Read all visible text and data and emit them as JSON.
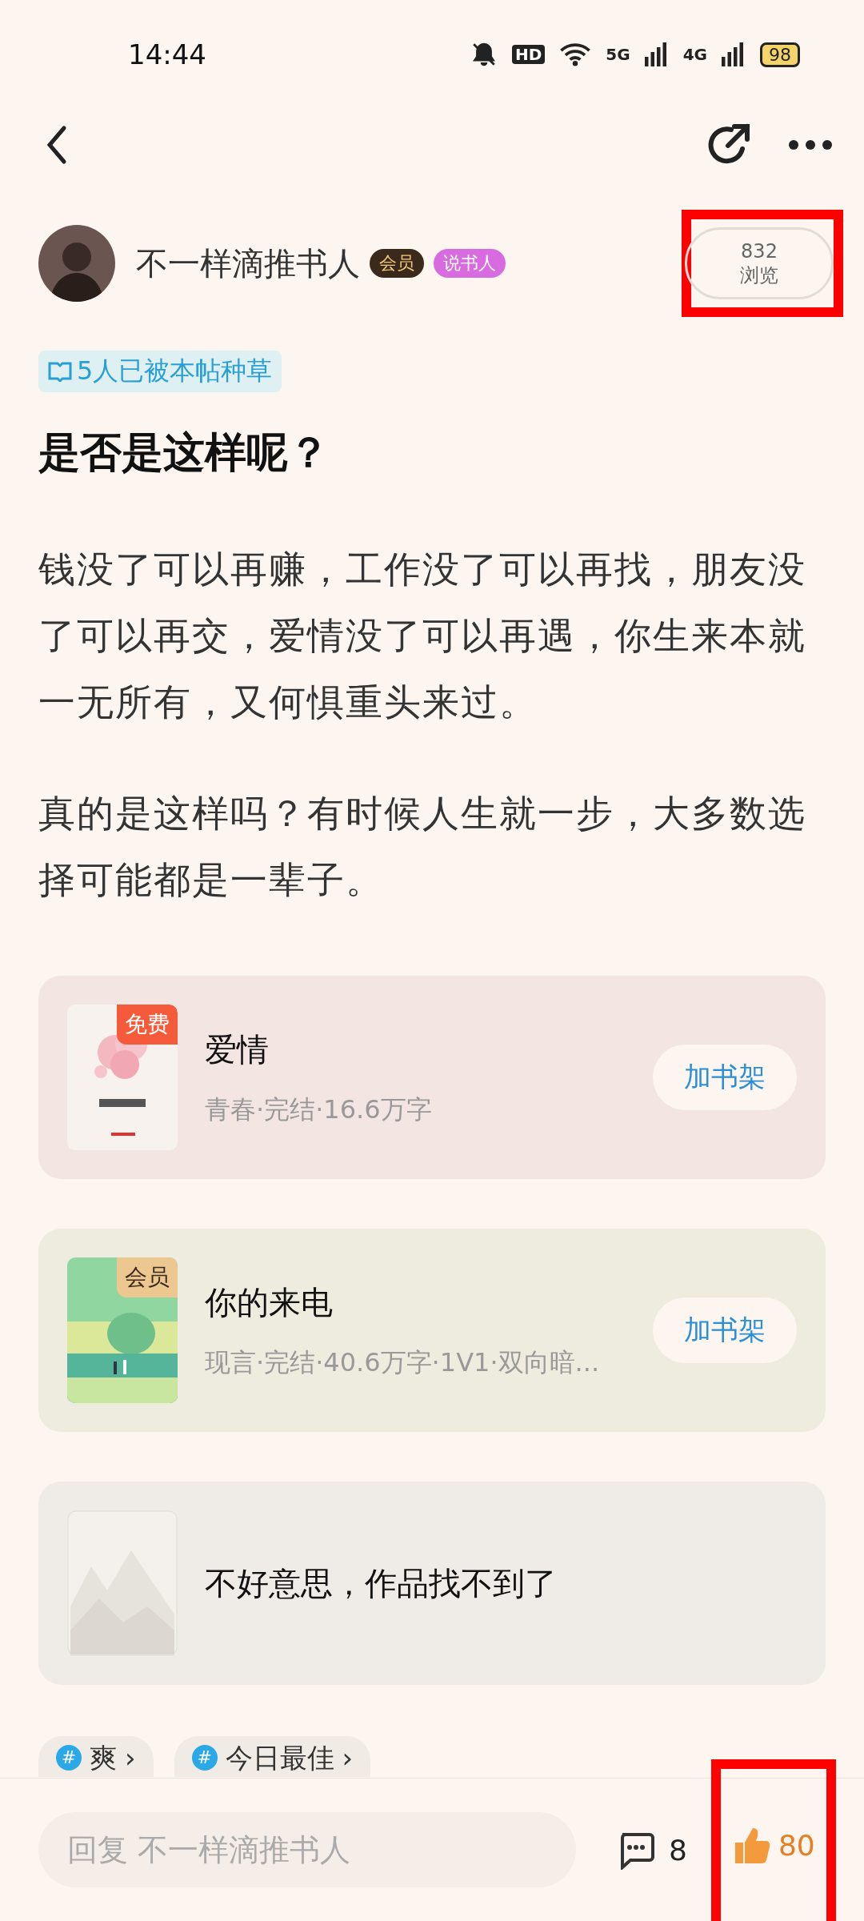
{
  "status_bar": {
    "time": "14:44",
    "hd": "HD",
    "net1": "5G",
    "net2": "4G",
    "battery": "98"
  },
  "author": {
    "name": "不一样滴推书人",
    "badges": [
      {
        "kind": "member",
        "label": "会员"
      },
      {
        "kind": "storyteller",
        "label": "说书人"
      }
    ],
    "views": {
      "count": "832",
      "label": "浏览",
      "highlighted": true
    }
  },
  "seeded_tag": "5人已被本帖种草",
  "title": "是否是这样呢？",
  "paragraphs": [
    "钱没了可以再赚，工作没了可以再找，朋友没了可以再交，爱情没了可以再遇，你生来本就一无所有，又何惧重头来过。",
    "真的是这样吗？有时候人生就一步，大多数选择可能都是一辈子。"
  ],
  "books": [
    {
      "kind": "book",
      "title": "爱情",
      "meta": "青春·完结·16.6万字",
      "badge": {
        "kind": "free",
        "label": "免费"
      },
      "button": "加书架"
    },
    {
      "kind": "book",
      "title": "你的来电",
      "meta": "现言·完结·40.6万字·1V1·双向暗...",
      "badge": {
        "kind": "member",
        "label": "会员"
      },
      "button": "加书架"
    },
    {
      "kind": "missing",
      "title": "不好意思，作品找不到了"
    }
  ],
  "topics": [
    {
      "hash": "#",
      "label": "爽",
      "arrow": "›"
    },
    {
      "hash": "#",
      "label": "今日最佳",
      "arrow": "›"
    }
  ],
  "bottom_bar": {
    "reply_placeholder": "回复 不一样滴推书人",
    "comments": "8",
    "likes": "80",
    "liked": true,
    "highlighted": true
  }
}
